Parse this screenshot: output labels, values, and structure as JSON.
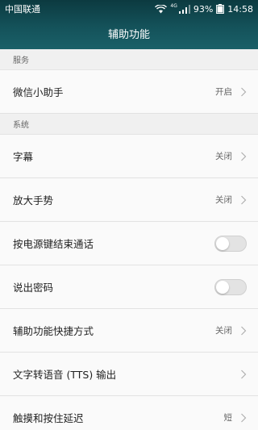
{
  "status_bar": {
    "carrier": "中国联通",
    "network": "4G",
    "battery": "93%",
    "time": "14:58"
  },
  "title": "辅助功能",
  "sections": [
    {
      "header": "服务",
      "items": [
        {
          "label": "微信小助手",
          "value": "开启",
          "control": "chevron"
        }
      ]
    },
    {
      "header": "系统",
      "items": [
        {
          "label": "字幕",
          "value": "关闭",
          "control": "chevron"
        },
        {
          "label": "放大手势",
          "value": "关闭",
          "control": "chevron"
        },
        {
          "label": "按电源键结束通话",
          "control": "toggle",
          "on": false
        },
        {
          "label": "说出密码",
          "control": "toggle",
          "on": false
        },
        {
          "label": "辅助功能快捷方式",
          "value": "关闭",
          "control": "chevron"
        },
        {
          "label": "文字转语音 (TTS) 输出",
          "control": "chevron"
        },
        {
          "label": "触摸和按住延迟",
          "value": "短",
          "control": "chevron"
        }
      ]
    }
  ],
  "icons": [
    "wifi-icon",
    "signal-icon",
    "battery-icon",
    "chevron-right-icon"
  ],
  "colors": {
    "header_bg": "#14525a",
    "toggle_off": "#e3e3e3"
  }
}
